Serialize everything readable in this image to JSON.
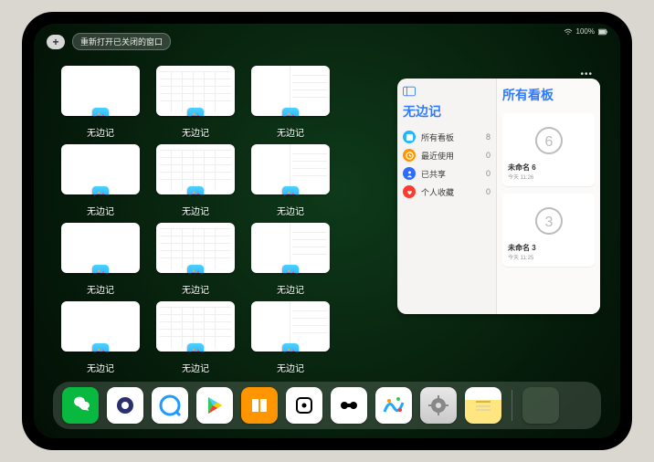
{
  "status": {
    "battery": "100%"
  },
  "topbar": {
    "reopen_label": "重新打开已关闭的窗口",
    "plus_label": "+"
  },
  "window_label": "无边记",
  "windows": [
    {
      "type": "blank"
    },
    {
      "type": "calendar"
    },
    {
      "type": "split"
    },
    null,
    {
      "type": "blank"
    },
    {
      "type": "calendar"
    },
    {
      "type": "split"
    },
    null,
    {
      "type": "blank"
    },
    {
      "type": "calendar"
    },
    {
      "type": "split"
    },
    null,
    {
      "type": "blank"
    },
    {
      "type": "calendar"
    },
    {
      "type": "split"
    },
    null
  ],
  "panel": {
    "left_title": "无边记",
    "right_title": "所有看板",
    "items": [
      {
        "icon": "blue",
        "label": "所有看板",
        "count": "8"
      },
      {
        "icon": "orange",
        "label": "最近使用",
        "count": "0"
      },
      {
        "icon": "dblue",
        "label": "已共享",
        "count": "0"
      },
      {
        "icon": "red",
        "label": "个人收藏",
        "count": "0"
      }
    ],
    "cards": [
      {
        "digit": "6",
        "title": "未命名 6",
        "sub": "今天 11:26"
      },
      {
        "digit": "3",
        "title": "未命名 3",
        "sub": "今天 11:25"
      }
    ]
  },
  "dock": [
    {
      "name": "wechat",
      "class": "di-wechat"
    },
    {
      "name": "quark",
      "class": "di-quark"
    },
    {
      "name": "qqbrowser",
      "class": "di-qq"
    },
    {
      "name": "play",
      "class": "di-play"
    },
    {
      "name": "books",
      "class": "di-books"
    },
    {
      "name": "dice",
      "class": "di-dice"
    },
    {
      "name": "barbell",
      "class": "di-bar"
    },
    {
      "name": "freeform",
      "class": "di-free"
    },
    {
      "name": "settings",
      "class": "di-set"
    },
    {
      "name": "notes",
      "class": "di-notes"
    }
  ]
}
